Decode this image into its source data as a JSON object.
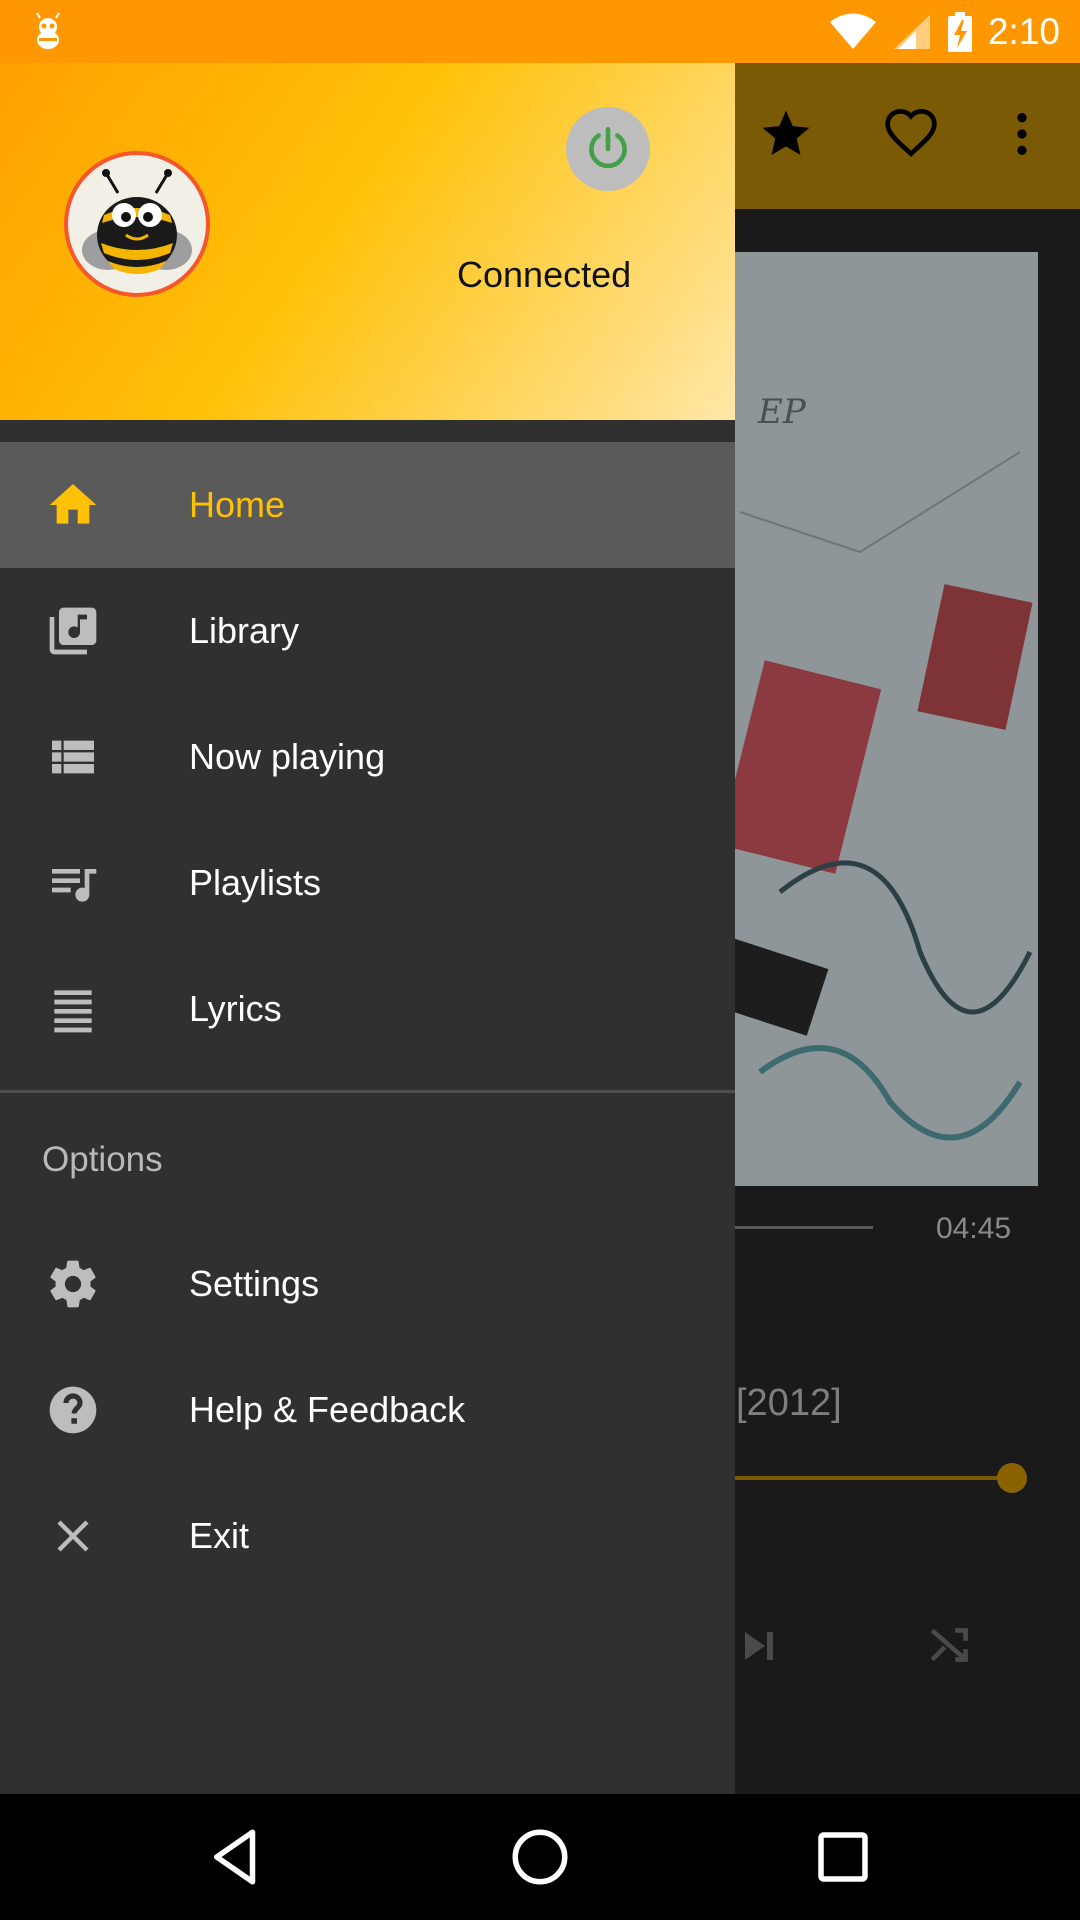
{
  "status_bar": {
    "time": "2:10",
    "app_icon": "bee-notification-icon",
    "icons": [
      "wifi-icon",
      "signal-icon",
      "battery-charging-icon"
    ]
  },
  "background_screen": {
    "toolbar_icons": [
      "star-icon",
      "heart-outline-icon",
      "more-vert-icon"
    ],
    "album_cover_text": "EP",
    "track_duration": "04:45",
    "album_year": "[2012]",
    "volume_fraction": 1.0
  },
  "drawer": {
    "header": {
      "connection_status": "Connected",
      "power_icon": "power-icon",
      "avatar": "bee-mascot-avatar"
    },
    "nav_items": [
      {
        "label": "Home",
        "icon": "home-icon",
        "active": true
      },
      {
        "label": "Library",
        "icon": "library-music-icon",
        "active": false
      },
      {
        "label": "Now playing",
        "icon": "view-list-icon",
        "active": false
      },
      {
        "label": "Playlists",
        "icon": "queue-music-icon",
        "active": false
      },
      {
        "label": "Lyrics",
        "icon": "lyrics-icon",
        "active": false
      }
    ],
    "options_title": "Options",
    "option_items": [
      {
        "label": "Settings",
        "icon": "gear-icon"
      },
      {
        "label": "Help & Feedback",
        "icon": "help-icon"
      },
      {
        "label": "Exit",
        "icon": "close-icon"
      }
    ]
  },
  "colors": {
    "status_bar": "#ff9800",
    "accent": "#ffc107",
    "drawer_bg": "#303030",
    "active_item_bg": "#5a5a5a",
    "power_green": "#43a047",
    "avatar_border": "#f5572a"
  },
  "system_nav": [
    "back-icon",
    "home-circle-icon",
    "recents-icon"
  ]
}
